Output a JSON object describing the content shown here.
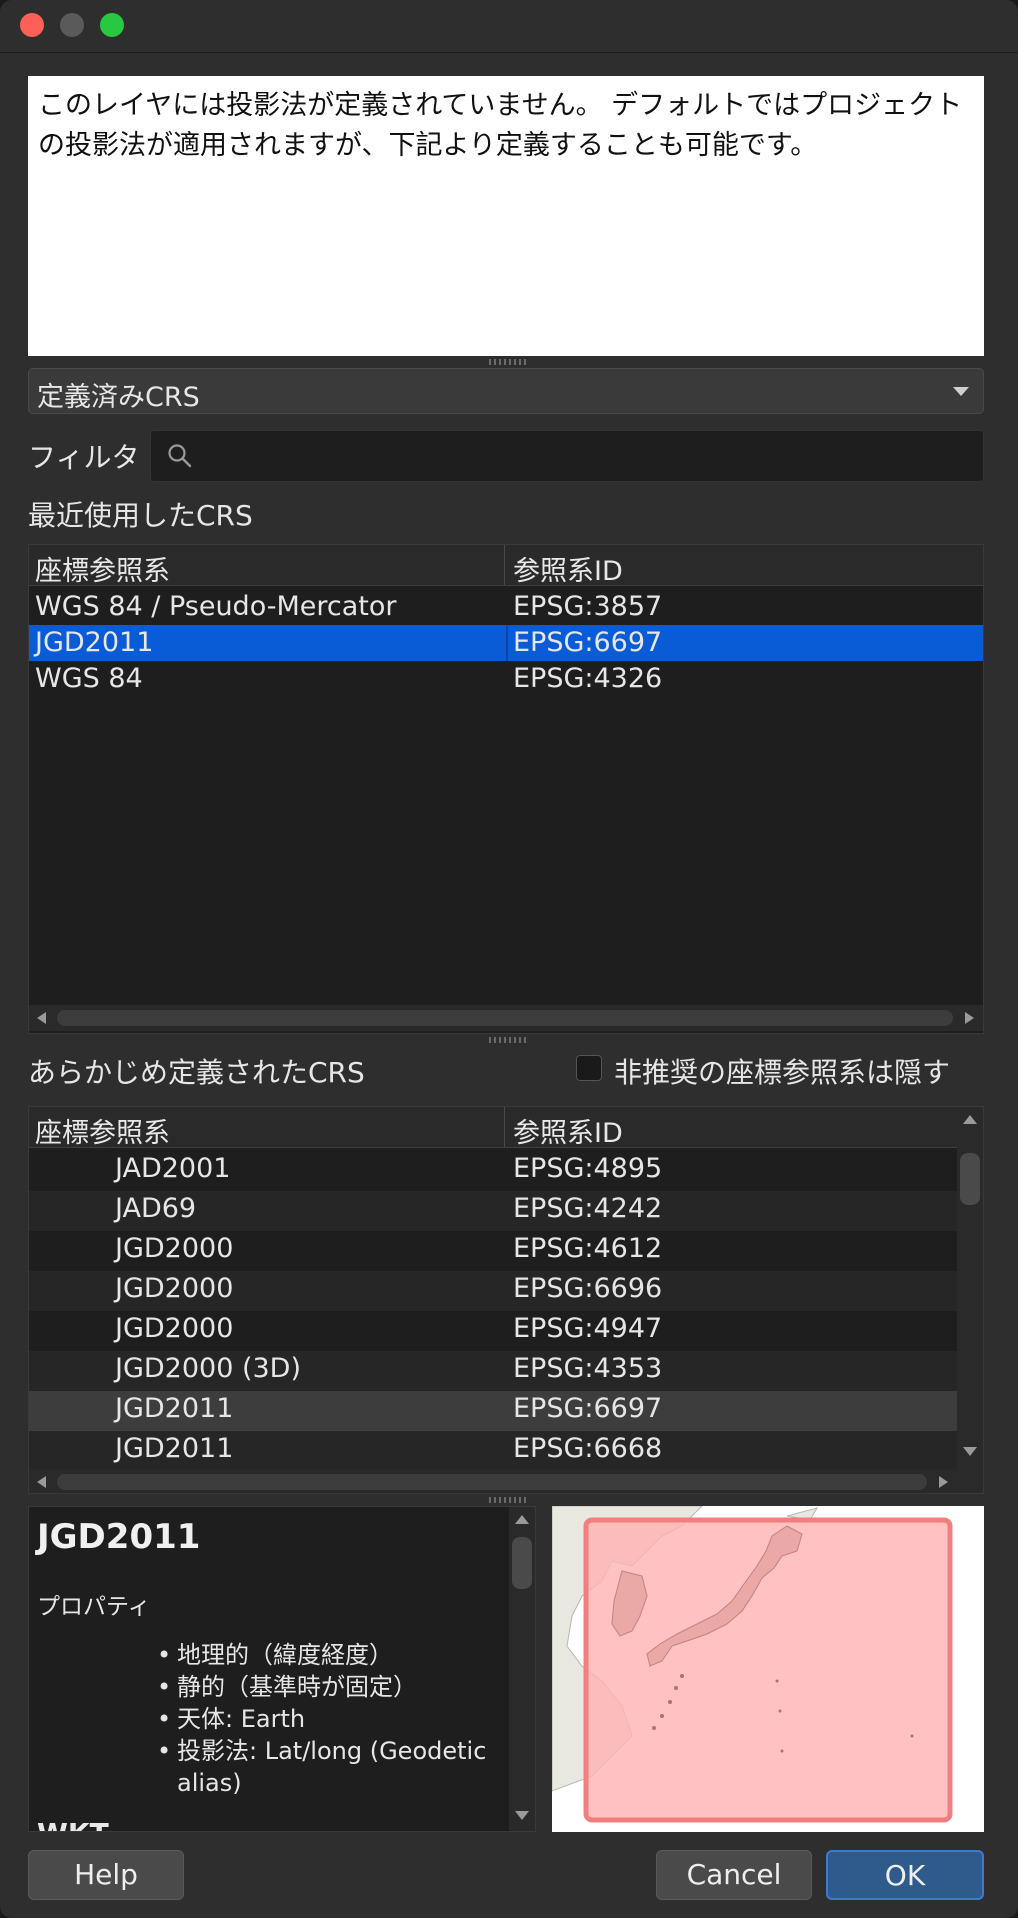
{
  "message": {
    "text": "このレイヤには投影法が定義されていません。 デフォルトではプロジェクトの投影法が適用されますが、下記より定義することも可能です。"
  },
  "crs_mode": {
    "selected": "定義済みCRS"
  },
  "filter": {
    "label": "フィルタ",
    "value": ""
  },
  "recent": {
    "label": "最近使用したCRS",
    "columns": [
      "座標参照系",
      "参照系ID"
    ],
    "rows": [
      {
        "name": "WGS 84 / Pseudo-Mercator",
        "id": "EPSG:3857"
      },
      {
        "name": "JGD2011",
        "id": "EPSG:6697"
      },
      {
        "name": "WGS 84",
        "id": "EPSG:4326"
      }
    ],
    "selected_index": 1
  },
  "predefined": {
    "label": "あらかじめ定義されたCRS",
    "hide_deprecated_label": "非推奨の座標参照系は隠す",
    "columns": [
      "座標参照系",
      "参照系ID"
    ],
    "rows": [
      {
        "name": "JAD2001",
        "id": "EPSG:4895"
      },
      {
        "name": "JAD69",
        "id": "EPSG:4242"
      },
      {
        "name": "JGD2000",
        "id": "EPSG:4612"
      },
      {
        "name": "JGD2000",
        "id": "EPSG:6696"
      },
      {
        "name": "JGD2000",
        "id": "EPSG:4947"
      },
      {
        "name": "JGD2000 (3D)",
        "id": "EPSG:4353"
      },
      {
        "name": "JGD2011",
        "id": "EPSG:6697"
      },
      {
        "name": "JGD2011",
        "id": "EPSG:6668"
      }
    ],
    "selected_index": 6
  },
  "info": {
    "title": "JGD2011",
    "properties_label": "プロパティ",
    "properties": [
      "地理的（緯度経度）",
      "静的（基準時が固定）",
      "天体: Earth",
      "投影法: Lat/long (Geodetic alias)"
    ],
    "wkt_label": "WKT"
  },
  "buttons": {
    "help": "Help",
    "cancel": "Cancel",
    "ok": "OK"
  },
  "colors": {
    "selection": "#0a5bd6",
    "extent_fill": "#ffb3b3",
    "extent_stroke": "#f08080",
    "land": "#e8e8e0"
  }
}
